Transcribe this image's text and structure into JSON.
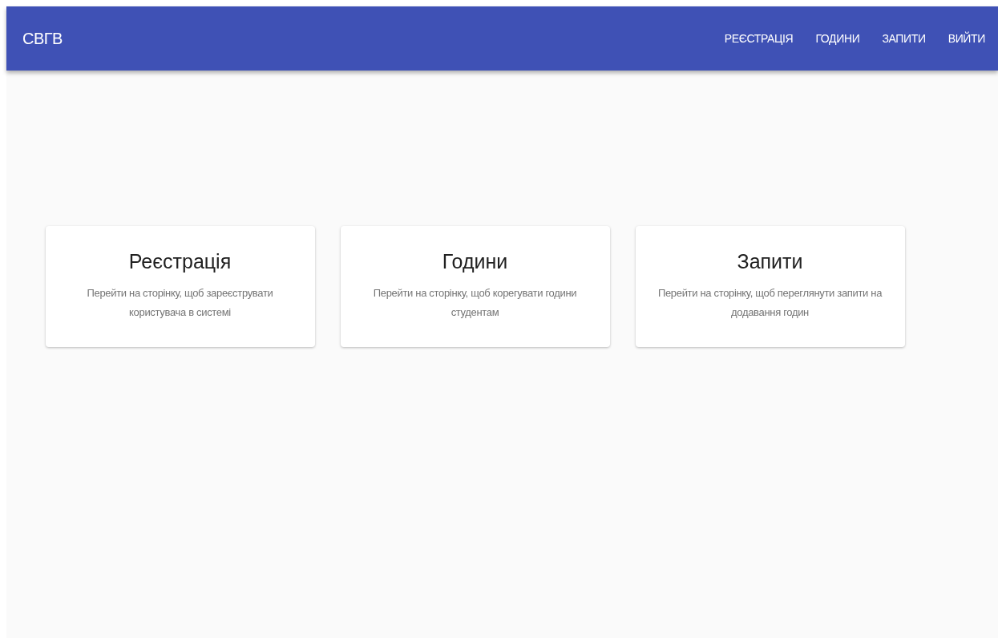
{
  "app_bar": {
    "title": "СВГВ",
    "nav": [
      "РЕЄСТРАЦІЯ",
      "ГОДИНИ",
      "ЗАПИТИ",
      "ВИЙТИ"
    ]
  },
  "cards": [
    {
      "title": "Реєстрація",
      "description": "Перейти на сторінку, щоб зареєструвати користувача в системі"
    },
    {
      "title": "Години",
      "description": "Перейти на сторінку, щоб корегувати години студентам"
    },
    {
      "title": "Запити",
      "description": "Перейти на сторінку, щоб переглянути запити на додавання годин"
    }
  ]
}
